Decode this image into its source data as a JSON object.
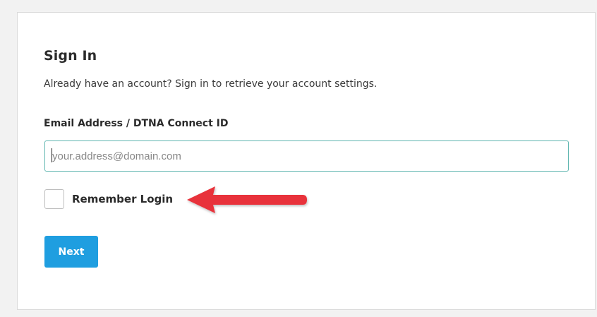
{
  "signin": {
    "title": "Sign In",
    "subtitle": "Already have an account? Sign in to retrieve your account settings.",
    "email_label": "Email Address / DTNA Connect ID",
    "email_placeholder": "your.address@domain.com",
    "email_value": "",
    "remember_label": "Remember Login",
    "remember_checked": false,
    "next_label": "Next"
  },
  "colors": {
    "accent_button": "#1f9ee0",
    "input_border": "#5fb6b0",
    "annotation_arrow": "#e8313a"
  },
  "icons": {
    "annotation": "red-arrow-icon"
  }
}
